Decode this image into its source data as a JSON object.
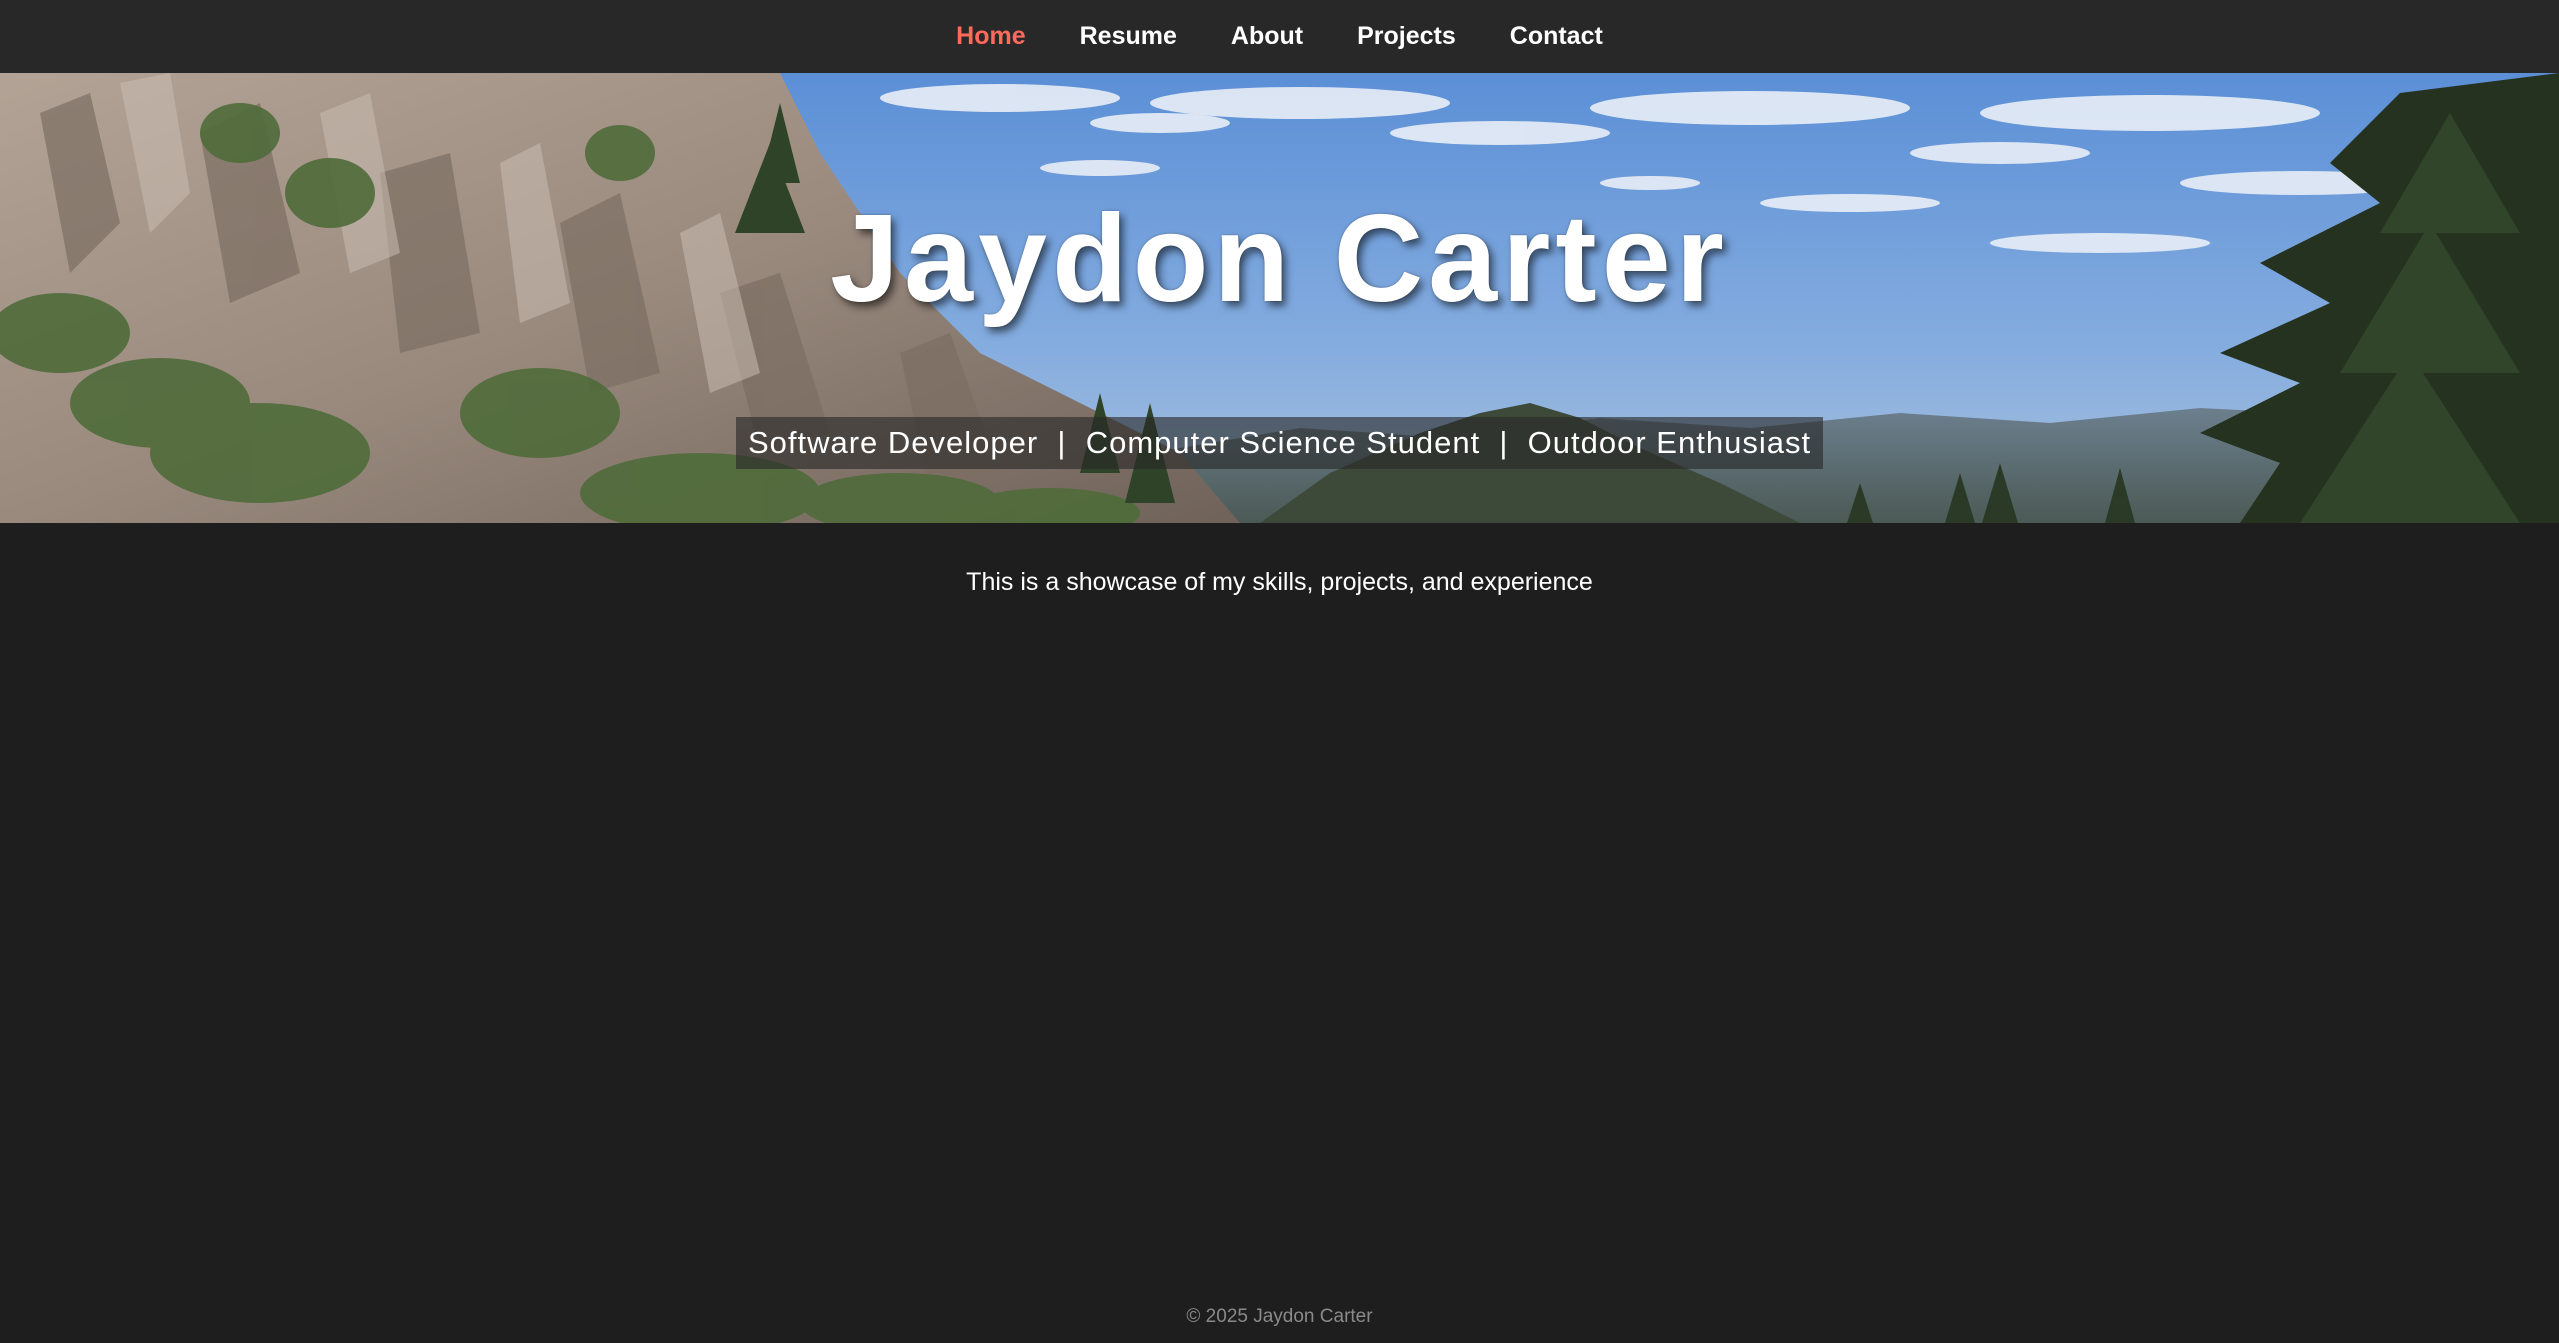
{
  "nav": {
    "items": [
      {
        "label": "Home",
        "active": true
      },
      {
        "label": "Resume",
        "active": false
      },
      {
        "label": "About",
        "active": false
      },
      {
        "label": "Projects",
        "active": false
      },
      {
        "label": "Contact",
        "active": false
      }
    ]
  },
  "hero": {
    "title": "Jaydon Carter",
    "subtitle": "Software Developer  |  Computer Science Student  |  Outdoor Enthusiast",
    "background": "hero-background-image"
  },
  "main": {
    "intro": "This is a showcase of my skills, projects, and experience"
  },
  "footer": {
    "copyright": "© 2025 Jaydon Carter"
  },
  "colors": {
    "page_bg": "#1e1e1e",
    "nav_bg": "#282828",
    "active_link": "#ff6b5b",
    "text": "#ffffff",
    "footer_text": "#8a8a8a"
  }
}
